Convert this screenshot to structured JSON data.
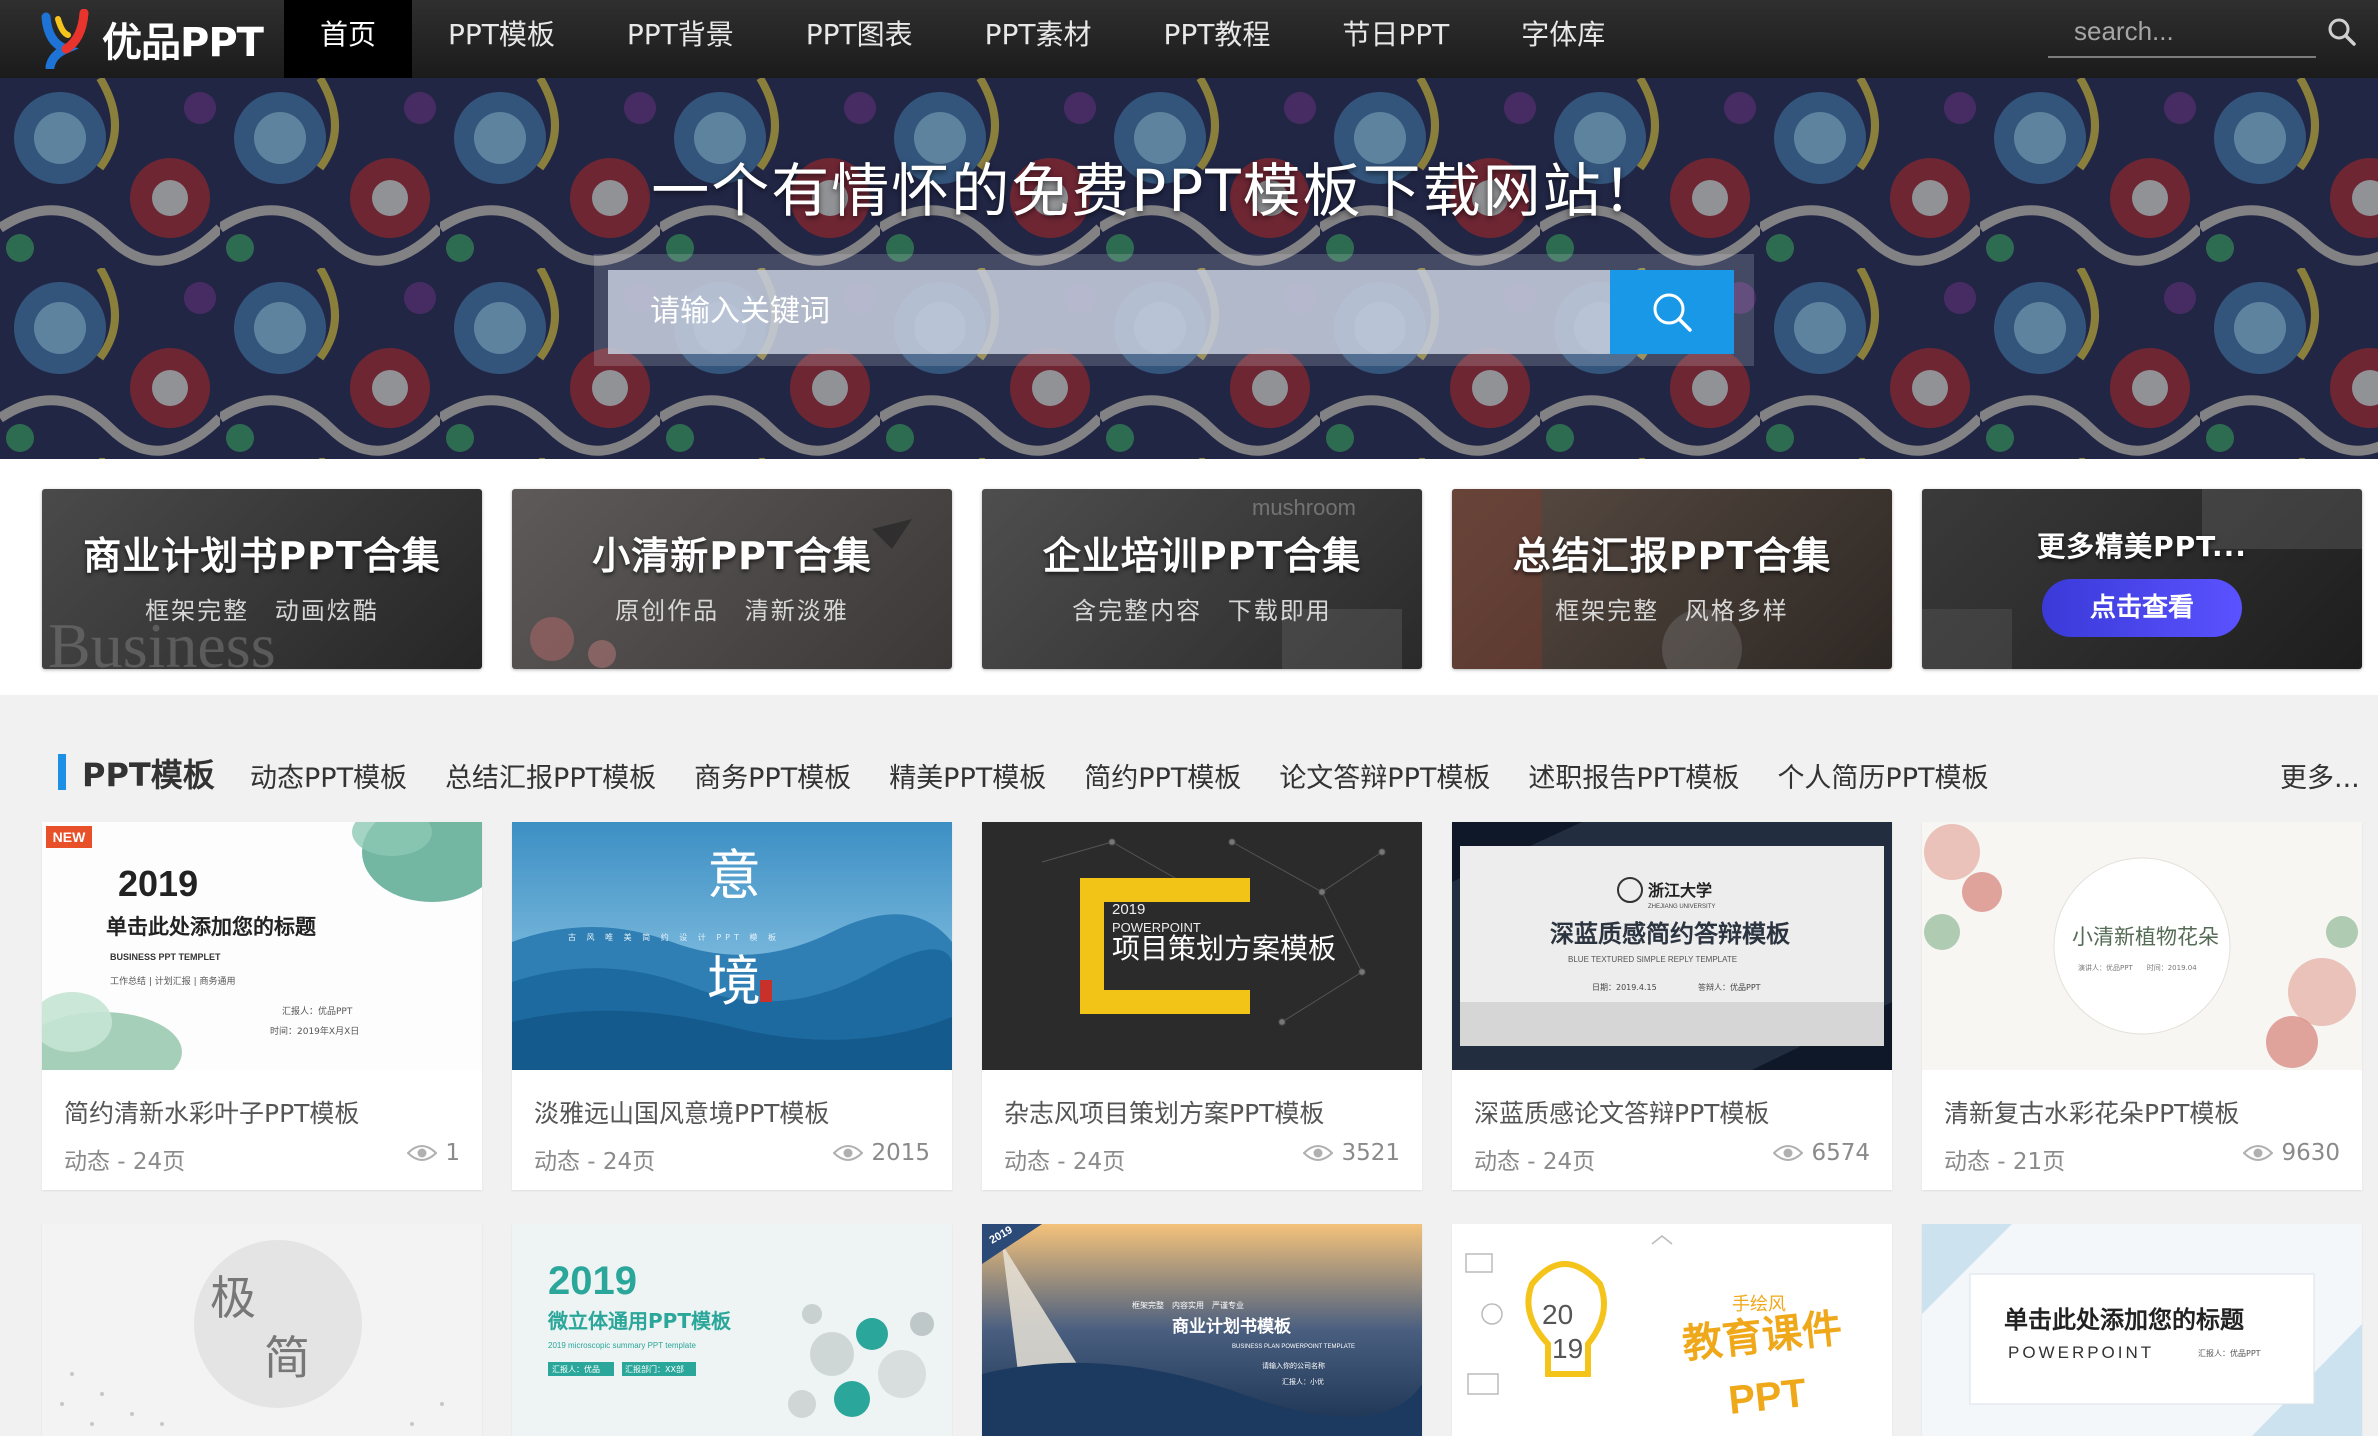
{
  "header": {
    "logo_text": "优品PPT",
    "nav": [
      "首页",
      "PPT模板",
      "PPT背景",
      "PPT图表",
      "PPT素材",
      "PPT教程",
      "节日PPT",
      "字体库"
    ],
    "search_placeholder": "search..."
  },
  "hero": {
    "title": "一个有情怀的免费PPT模板下载网站！",
    "search_placeholder": "请输入关键词"
  },
  "banners": [
    {
      "title": "商业计划书PPT合集",
      "subtitle": "框架完整 动画炫酷",
      "bg_text": "Business"
    },
    {
      "title": "小清新PPT合集",
      "subtitle": "原创作品 清新淡雅"
    },
    {
      "title": "企业培训PPT合集",
      "subtitle": "含完整内容 下载即用",
      "bg_text": "mushroom"
    },
    {
      "title": "总结汇报PPT合集",
      "subtitle": "框架完整 风格多样"
    },
    {
      "title": "更多精美PPT...",
      "cta": "点击查看"
    }
  ],
  "category": {
    "title": "PPT模板",
    "links": [
      "动态PPT模板",
      "总结汇报PPT模板",
      "商务PPT模板",
      "精美PPT模板",
      "简约PPT模板",
      "论文答辩PPT模板",
      "述职报告PPT模板",
      "个人简历PPT模板"
    ],
    "more": "更多..."
  },
  "cards_row1": [
    {
      "title": "简约清新水彩叶子PPT模板",
      "meta": "动态 - 24页",
      "views": "1",
      "badge": "NEW",
      "thumb": {
        "year": "2019",
        "heading": "单击此处添加您的标题",
        "sub": "BUSINESS PPT TEMPLET",
        "tags": "工作总结 | 计划汇报 | 商务通用",
        "reporter": "汇报人：优品PPT",
        "date": "时间：2019年X月X日"
      }
    },
    {
      "title": "淡雅远山国风意境PPT模板",
      "meta": "动态 - 24页",
      "views": "2015",
      "thumb": {
        "char1": "意",
        "char2": "境",
        "line": "古 风 唯 美 简 约 设 计 PPT 模 板"
      }
    },
    {
      "title": "杂志风项目策划方案PPT模板",
      "meta": "动态 - 24页",
      "views": "3521",
      "thumb": {
        "year": "2019",
        "sub": "POWERPOINT",
        "heading": "项目策划方案模板"
      }
    },
    {
      "title": "深蓝质感论文答辩PPT模板",
      "meta": "动态 - 24页",
      "views": "6574",
      "thumb": {
        "school": "浙江大学",
        "school_en": "ZHEJIANG UNIVERSITY",
        "heading": "深蓝质感简约答辩模板",
        "sub": "BLUE TEXTURED SIMPLE REPLY TEMPLATE",
        "date": "日期：2019.4.15",
        "reporter": "答辩人：优品PPT"
      }
    },
    {
      "title": "清新复古水彩花朵PPT模板",
      "meta": "动态 - 21页",
      "views": "9630",
      "thumb": {
        "heading": "小清新植物花朵",
        "sub": "演讲人：优品PPT　　时间：2019.04"
      }
    }
  ],
  "cards_row2": [
    {
      "thumb": {
        "char1": "极",
        "char2": "简"
      }
    },
    {
      "thumb": {
        "year": "2019",
        "heading": "微立体通用PPT模板",
        "sub": "2019 microscopic summary PPT template",
        "tag1": "汇报人：优品",
        "tag2": "汇报部门：XX部"
      }
    },
    {
      "thumb": {
        "corner": "2019",
        "tags": "框架完整　内容实用　严谨专业",
        "heading": "商业计划书模板",
        "sub": "BUSINESS PLAN POWERPOINT TEMPLATE",
        "line1": "请输入你的公司名称",
        "line2": "汇报人：小优"
      }
    },
    {
      "thumb": {
        "year1": "20",
        "year2": "19",
        "tag": "手绘风",
        "heading": "教育课件",
        "ppt": "PPT"
      }
    },
    {
      "thumb": {
        "heading": "单击此处添加您的标题",
        "sub": "POWERPOINT",
        "reporter": "汇报人：优品PPT"
      }
    }
  ],
  "colors": {
    "accent": "#1a98e8",
    "nav_bg": "#1f1f1f",
    "cta": "#4b44f0"
  }
}
